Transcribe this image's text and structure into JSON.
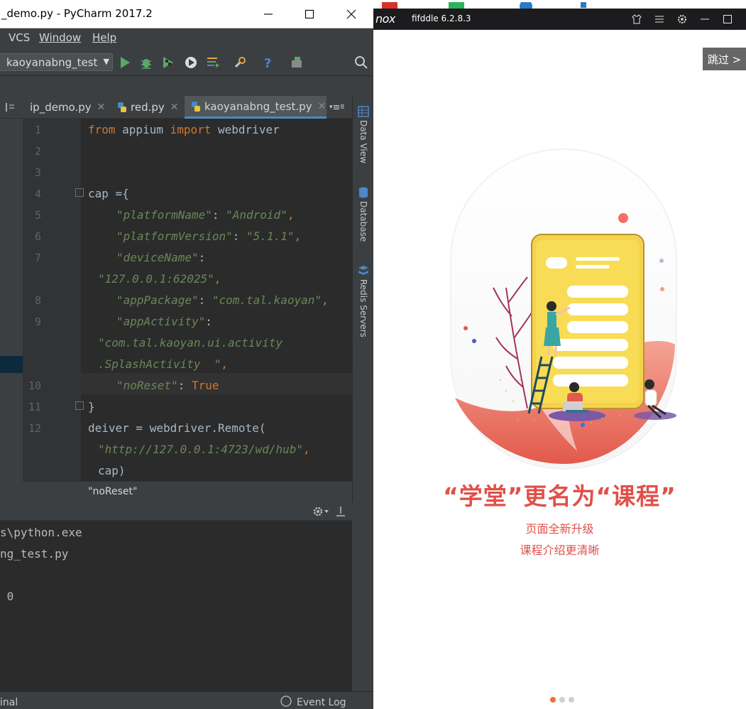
{
  "pycharm": {
    "title": "_demo.py - PyCharm 2017.2",
    "menu": {
      "vcs": "VCS",
      "window": "Window",
      "help": "Help"
    },
    "run_config": "kaoyanabng_test",
    "tabs": [
      {
        "label": "ip_demo.py",
        "active": false
      },
      {
        "label": "red.py",
        "active": false
      },
      {
        "label": "kaoyanabng_test.py",
        "active": true
      }
    ],
    "tab_overflow": "≡",
    "tab_overflow_count": "8",
    "line_numbers": [
      "1",
      "2",
      "3",
      "4",
      "5",
      "6",
      "7",
      "8",
      "9",
      "10",
      "11",
      "12"
    ],
    "code": {
      "l1_from": "from",
      "l1_mod": " appium ",
      "l1_import": "import",
      "l1_name": " webdriver",
      "l4": "cap ={",
      "l5_key": "\"platformName\"",
      "l5_sep": ": ",
      "l5_val": "\"Android\"",
      "l5_end": ",",
      "l6_key": "\"platformVersion\"",
      "l6_sep": ": ",
      "l6_val": "\"5.1.1\"",
      "l6_end": ",",
      "l7_key": "\"deviceName\"",
      "l7_sep": ":",
      "l7b_val": "\"127.0.0.1:62025\"",
      "l7b_end": ",",
      "l8_key": "\"appPackage\"",
      "l8_sep": ": ",
      "l8_val": "\"com.tal.kaoyan\"",
      "l8_end": ",",
      "l9_key": "\"appActivity\"",
      "l9_sep": ":",
      "l9b_val": "\"com.tal.kaoyan.ui.activity",
      "l9c_val": ".SplashActivity  \"",
      "l9c_end": ",",
      "l10_key": "\"noReset\"",
      "l10_sep": ": ",
      "l10_val": "True",
      "l11": "}",
      "l12": "deiver = webdriver.Remote(",
      "l12b_val": "\"http://127.0.0.1:4723/wd/hub\"",
      "l12b_end": ",",
      "l12c": "cap)"
    },
    "breadcrumb": "\"noReset\"",
    "tool_windows": [
      "Data View",
      "Database",
      "Redis Servers"
    ],
    "console": [
      "s\\python.exe",
      "ng_test.py",
      "",
      " 0"
    ],
    "status": {
      "left": "inal",
      "event_log": "Event Log"
    },
    "colors": {
      "keyword": "#cc7832",
      "string": "#6a8759",
      "text": "#a9b7c6",
      "editor_bg": "#2b2b2b"
    }
  },
  "nox": {
    "logo": "nox",
    "app_name": "fifddle 6.2.8.3",
    "skip_label": "跳过 >",
    "headline": "“学堂”更名为“课程”",
    "subtitle1": "页面全新升级",
    "subtitle2": "课程介绍更清晰",
    "pager": {
      "count": 3,
      "active": 0
    },
    "colors": {
      "accent": "#e0504a",
      "pager_active": "#f26a3d"
    }
  }
}
